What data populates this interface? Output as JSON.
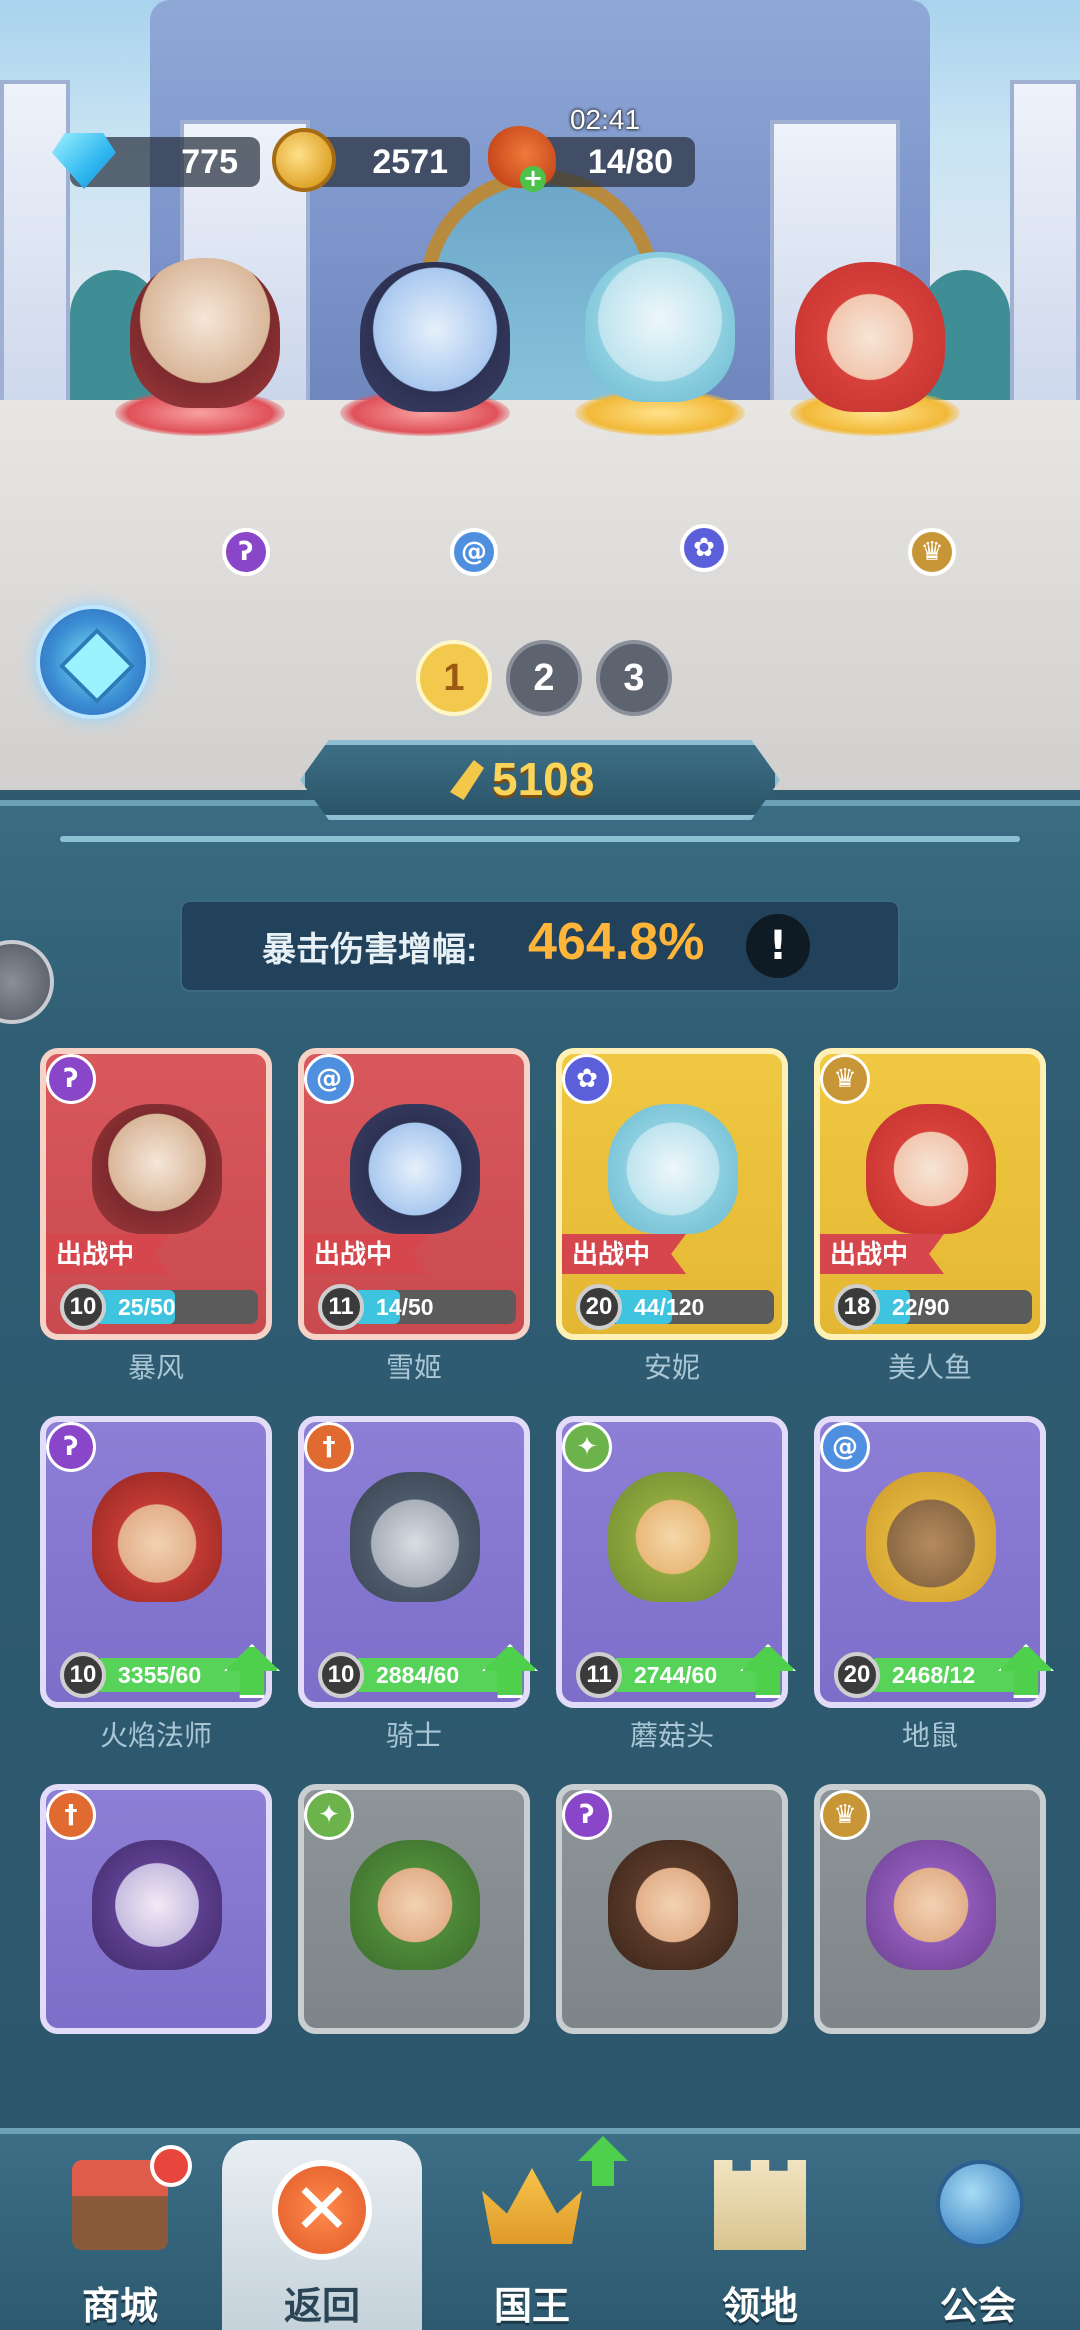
{
  "resources": {
    "gems": "775",
    "gold": "2571",
    "stamina": "14/80",
    "stamina_timer": "02:41"
  },
  "formation": {
    "pages": [
      "1",
      "2",
      "3"
    ],
    "active_page": "1",
    "heroes": [
      {
        "name": "暴风",
        "faction_icon": "wind-icon"
      },
      {
        "name": "雪姬",
        "faction_icon": "swirl-icon"
      },
      {
        "name": "安妮",
        "faction_icon": "paw-icon"
      },
      {
        "name": "美人鱼",
        "faction_icon": "crown-emblem-icon"
      }
    ]
  },
  "power": "5108",
  "crit_bonus": {
    "label": "暴击伤害增幅:",
    "value": "464.8%",
    "info_glyph": "!"
  },
  "hero_cards": [
    {
      "name": "暴风",
      "level": "10",
      "progress": "25/50",
      "progress_ratio": 0.5,
      "status": "出战中",
      "style": "red",
      "faction": "wind-icon"
    },
    {
      "name": "雪姬",
      "level": "11",
      "progress": "14/50",
      "progress_ratio": 0.28,
      "status": "出战中",
      "style": "red",
      "faction": "swirl-icon"
    },
    {
      "name": "安妮",
      "level": "20",
      "progress": "44/120",
      "progress_ratio": 0.37,
      "status": "出战中",
      "style": "yellow",
      "faction": "paw-icon"
    },
    {
      "name": "美人鱼",
      "level": "18",
      "progress": "22/90",
      "progress_ratio": 0.24,
      "status": "出战中",
      "style": "yellow",
      "faction": "crown-emblem-icon"
    },
    {
      "name": "火焰法师",
      "level": "10",
      "progress": "3355/60",
      "progress_ratio": 1,
      "style": "purple",
      "faction": "wind-icon",
      "upgradable": true
    },
    {
      "name": "骑士",
      "level": "10",
      "progress": "2884/60",
      "progress_ratio": 1,
      "style": "purple",
      "faction": "sword-icon",
      "upgradable": true
    },
    {
      "name": "蘑菇头",
      "level": "11",
      "progress": "2744/60",
      "progress_ratio": 1,
      "style": "purple",
      "faction": "star-icon",
      "upgradable": true
    },
    {
      "name": "地鼠",
      "level": "20",
      "progress": "2468/12",
      "progress_ratio": 1,
      "style": "purple",
      "faction": "swirl-icon",
      "upgradable": true
    },
    {
      "style": "purple",
      "faction": "sword-icon"
    },
    {
      "style": "gray",
      "faction": "star-icon"
    },
    {
      "style": "gray",
      "faction": "wind-icon"
    },
    {
      "style": "gray",
      "faction": "crown-emblem-icon"
    }
  ],
  "nav": [
    {
      "label": "商城",
      "icon": "shop-icon"
    },
    {
      "label": "返回",
      "icon": "close-icon",
      "glyph": "✕",
      "active": true
    },
    {
      "label": "国王",
      "icon": "crown-icon"
    },
    {
      "label": "领地",
      "icon": "castle-icon"
    },
    {
      "label": "公会",
      "icon": "planet-icon"
    }
  ],
  "colors": {
    "crit_value": "#ffb43a",
    "power_value": "#fbd55a",
    "active_tag": "#d6474d",
    "upgrade_arrow": "#4fd04c"
  }
}
